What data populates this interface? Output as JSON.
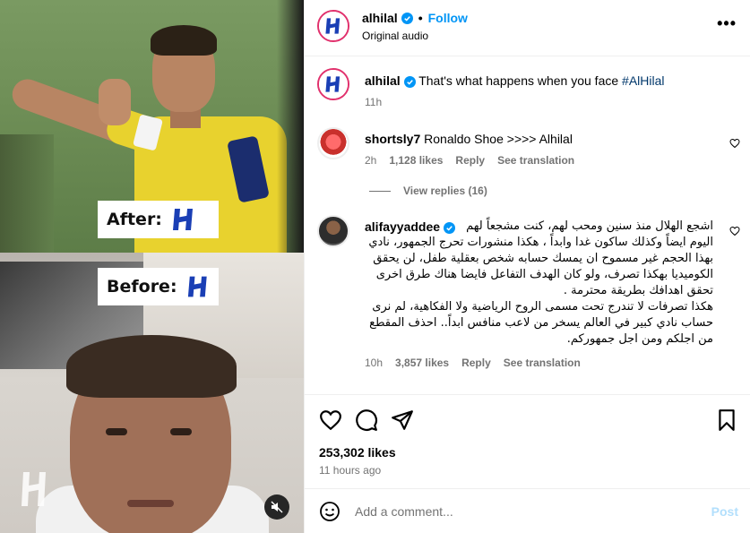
{
  "media": {
    "label_after": "After:",
    "label_before": "Before:",
    "mute_icon": "muted-speaker-icon"
  },
  "header": {
    "username": "alhilal",
    "dot": "•",
    "follow_label": "Follow",
    "audio": "Original audio",
    "more_label": "•••"
  },
  "caption": {
    "username": "alhilal",
    "text": "That's what happens when you face ",
    "hashtag": "#AlHilal",
    "time": "11h"
  },
  "comments": [
    {
      "username": "shortsly7",
      "text": "Ronaldo Shoe >>>> Alhilal",
      "time": "2h",
      "likes": "1,128 likes",
      "reply": "Reply",
      "translate": "See translation",
      "view_replies": "View replies (16)"
    },
    {
      "username": "alifayyaddee",
      "line1": "اشجع الهلال منذ سنين ومحب لهم، كنت مشجعاً لهم",
      "text_rest": "اليوم ايضاً وكذلك ساكون غدا وابداً ، هكذا منشورات تحرج الجمهور، نادي بهذا الحجم غير مسموح ان يمسك حسابه شخص بعقلية طفل، لن يحقق الكوميديا بهكذا تصرف، ولو كان الهدف التفاعل فايضا هناك طرق اخرى تحقق اهدافك بطريقة محترمة .",
      "text_2": "هكذا تصرفات لا تندرج تحت مسمى الروح الرياضية ولا الفكاهية، لم نرى حساب نادي كبير في العالم يسخر من لاعب منافس ابداً.. احذف المقطع من اجلكم ومن اجل جمهوركم.",
      "time": "10h",
      "likes": "3,857 likes",
      "reply": "Reply",
      "translate": "See translation"
    }
  ],
  "actions": {
    "likes": "253,302 likes",
    "time_ago": "11 hours ago"
  },
  "add_comment": {
    "placeholder": "Add a comment...",
    "post_label": "Post"
  },
  "colors": {
    "accent": "#0095f6",
    "verified": "#0095f6",
    "muted": "#737373",
    "post_disabled": "#b2dffc"
  }
}
